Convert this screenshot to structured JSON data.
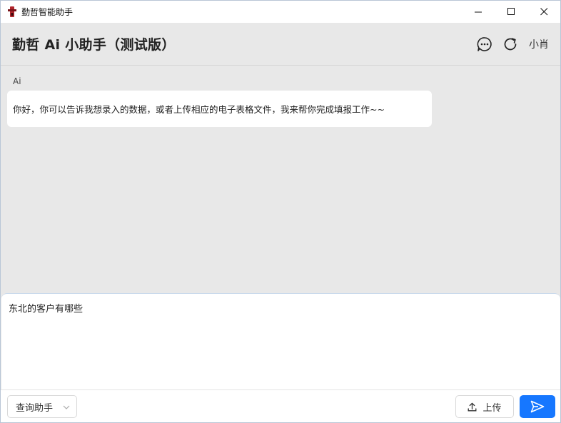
{
  "window": {
    "title": "勤哲智能助手"
  },
  "header": {
    "title": "勤哲 Ai 小助手（测试版）",
    "user_name": "小肖",
    "icons": [
      "chat-bubble-icon",
      "refresh-icon"
    ]
  },
  "chat": {
    "messages": [
      {
        "sender": "Ai",
        "text": "你好，你可以告诉我想录入的数据，或者上传相应的电子表格文件，我来帮你完成填报工作~~"
      }
    ]
  },
  "input": {
    "value": "东北的客户有哪些"
  },
  "toolbar": {
    "select_value": "查询助手",
    "upload_label": "上传",
    "send_icon": "send-icon"
  },
  "colors": {
    "accent": "#1677ff",
    "background": "#e8e8e8",
    "bubble": "#ffffff",
    "app_icon": "#b0262c"
  }
}
